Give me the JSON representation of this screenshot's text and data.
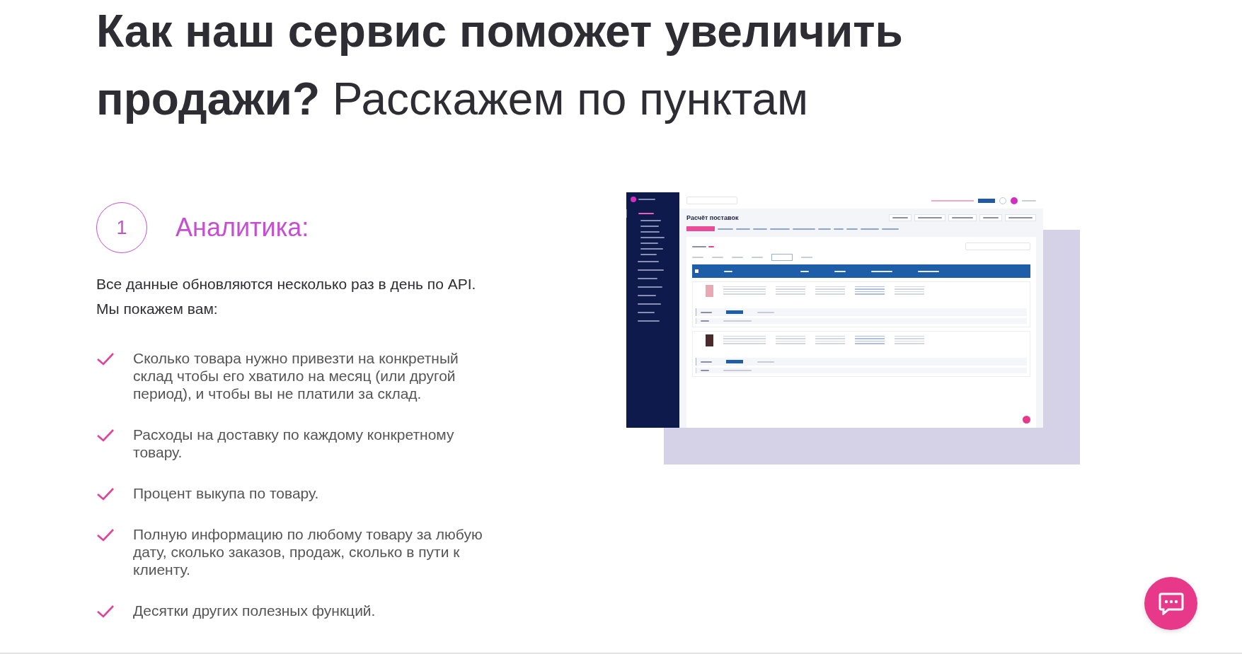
{
  "heading": "**Как наш сервис поможет увеличить продажи?** Расскажем по пунктам",
  "step": {
    "number": "1",
    "title": "Аналитика:"
  },
  "intro": "Все данные обновляются несколько раз в день по API. Мы покажем вам:",
  "benefits": [
    "Сколько товара нужно привезти на конкретный склад чтобы его хватило на месяц (или другой период), и чтобы вы не платили за склад.",
    "Расходы на доставку по каждому конкретному товару.",
    "Процент выкупа по товару.",
    "Полную информацию по любому товару за любую дату, сколько заказов, продаж, сколько в пути к клиенту.",
    "Десятки других полезных функций."
  ],
  "app_screenshot": {
    "title": "Расчёт поставок"
  }
}
